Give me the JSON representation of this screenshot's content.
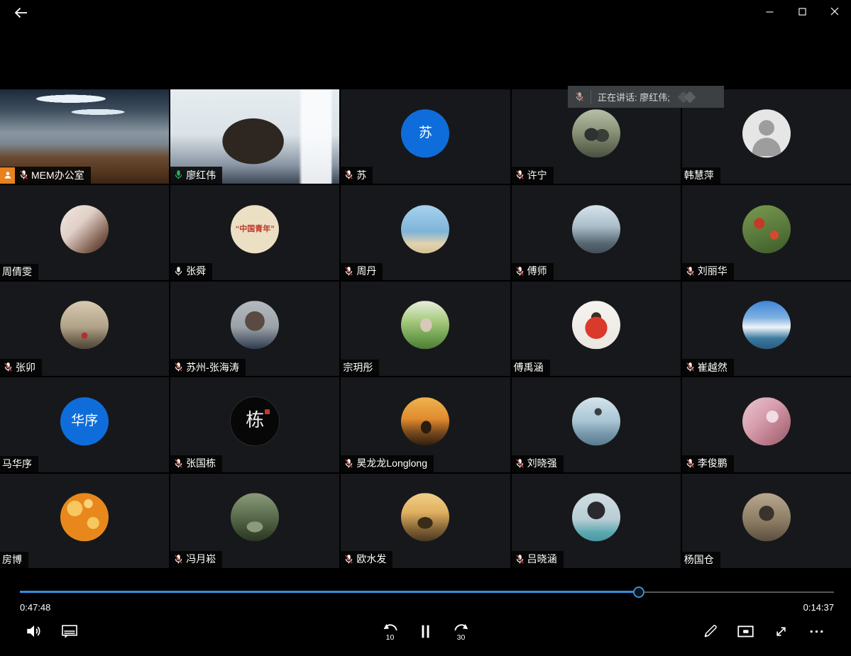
{
  "window": {
    "title": "video-player",
    "controls": {
      "minimize": "minimize",
      "maximize": "maximize",
      "close": "close"
    }
  },
  "toast": {
    "label": "正在讲话: 廖红伟;"
  },
  "player": {
    "elapsed": "0:47:48",
    "remaining": "0:14:37",
    "progress_percent": 76,
    "skip_back_label": "10",
    "skip_forward_label": "30"
  },
  "colors": {
    "accent_blue": "#3391de",
    "speaking_green": "#2aa55c",
    "active_mic_green": "#2db35a",
    "muted_slash_red": "#c0392b",
    "host_badge_orange": "#e8821e",
    "initials_avatar_blue": "#0f6ddb"
  },
  "participants": [
    {
      "name": "MEM办公室",
      "mic": "muted",
      "host": true,
      "avatar": {
        "kind": "video",
        "photo": "room"
      }
    },
    {
      "name": "廖红伟",
      "mic": "active",
      "speaking": true,
      "avatar": {
        "kind": "video",
        "photo": "person"
      }
    },
    {
      "name": "苏",
      "mic": "muted",
      "avatar": {
        "kind": "initials",
        "text": "苏"
      }
    },
    {
      "name": "许宁",
      "mic": "muted",
      "avatar": {
        "kind": "photo",
        "photo": "xuning"
      }
    },
    {
      "name": "韩慧萍",
      "mic": "none",
      "avatar": {
        "kind": "default"
      }
    },
    {
      "name": "周倩雯",
      "mic": "none",
      "avatar": {
        "kind": "photo",
        "photo": "zhouqianwen"
      }
    },
    {
      "name": "张舜",
      "mic": "open",
      "avatar": {
        "kind": "logo",
        "text": "“中国青年”",
        "photo": "zhangshun"
      }
    },
    {
      "name": "周丹",
      "mic": "muted",
      "avatar": {
        "kind": "photo",
        "photo": "zhoudan"
      }
    },
    {
      "name": "傅师",
      "mic": "muted",
      "avatar": {
        "kind": "photo",
        "photo": "fushi"
      }
    },
    {
      "name": "刘丽华",
      "mic": "muted",
      "avatar": {
        "kind": "photo",
        "photo": "liulihua"
      }
    },
    {
      "name": "张卯",
      "mic": "muted",
      "avatar": {
        "kind": "photo",
        "photo": "zhangmao"
      }
    },
    {
      "name": "苏州-张海涛",
      "mic": "muted",
      "avatar": {
        "kind": "photo",
        "photo": "zhanghaitao"
      }
    },
    {
      "name": "宗玥彤",
      "mic": "none",
      "avatar": {
        "kind": "photo",
        "photo": "zongyuetong"
      }
    },
    {
      "name": "傅禹涵",
      "mic": "none",
      "avatar": {
        "kind": "photo",
        "photo": "fuyuhan"
      }
    },
    {
      "name": "崔越然",
      "mic": "muted",
      "avatar": {
        "kind": "photo",
        "photo": "cuiyueran"
      }
    },
    {
      "name": "马华序",
      "mic": "none",
      "avatar": {
        "kind": "initials",
        "text": "华序"
      }
    },
    {
      "name": "张国栋",
      "mic": "muted",
      "avatar": {
        "kind": "logo-dark",
        "text": "栋"
      }
    },
    {
      "name": "昊龙龙Longlong",
      "mic": "muted",
      "avatar": {
        "kind": "photo",
        "photo": "haolonglong"
      }
    },
    {
      "name": "刘晓强",
      "mic": "muted",
      "avatar": {
        "kind": "photo",
        "photo": "liuxiaoqiang"
      }
    },
    {
      "name": "李俊鹏",
      "mic": "muted",
      "avatar": {
        "kind": "photo",
        "photo": "lijunpeng"
      }
    },
    {
      "name": "房博",
      "mic": "none",
      "avatar": {
        "kind": "photo",
        "photo": "fangbo"
      }
    },
    {
      "name": "冯月崧",
      "mic": "muted",
      "avatar": {
        "kind": "photo",
        "photo": "fengyuesong"
      }
    },
    {
      "name": "欧水发",
      "mic": "muted",
      "avatar": {
        "kind": "photo",
        "photo": "oushuifa"
      }
    },
    {
      "name": "吕晓涵",
      "mic": "muted",
      "avatar": {
        "kind": "photo",
        "photo": "lvxiaohan"
      }
    },
    {
      "name": "杨国仓",
      "mic": "none",
      "avatar": {
        "kind": "photo",
        "photo": "yangguocang"
      }
    }
  ]
}
